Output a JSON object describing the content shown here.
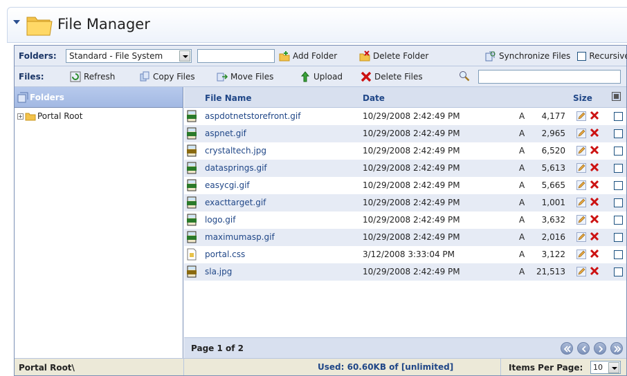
{
  "window": {
    "title": "File Manager"
  },
  "folders_bar": {
    "label": "Folders:",
    "provider_select": "Standard - File System",
    "folder_name_value": "",
    "add_folder": "Add Folder",
    "delete_folder": "Delete Folder",
    "synchronize_files": "Synchronize Files",
    "recursive": "Recursive"
  },
  "files_bar": {
    "label": "Files:",
    "refresh": "Refresh",
    "copy_files": "Copy Files",
    "move_files": "Move Files",
    "upload": "Upload",
    "delete_files": "Delete Files",
    "search_value": ""
  },
  "folders_panel": {
    "header": "Folders",
    "tree": [
      {
        "label": "Portal Root",
        "expanded": false
      }
    ]
  },
  "grid": {
    "columns": {
      "file_name": "File Name",
      "date": "Date",
      "size": "Size"
    },
    "rows": [
      {
        "name": "aspdotnetstorefront.gif",
        "date": "10/29/2008 2:42:49 PM",
        "attr": "A",
        "size": "4,177",
        "type": "GIF"
      },
      {
        "name": "aspnet.gif",
        "date": "10/29/2008 2:42:49 PM",
        "attr": "A",
        "size": "2,965",
        "type": "GIF"
      },
      {
        "name": "crystaltech.jpg",
        "date": "10/29/2008 2:42:49 PM",
        "attr": "A",
        "size": "6,520",
        "type": "JPG"
      },
      {
        "name": "datasprings.gif",
        "date": "10/29/2008 2:42:49 PM",
        "attr": "A",
        "size": "5,613",
        "type": "GIF"
      },
      {
        "name": "easycgi.gif",
        "date": "10/29/2008 2:42:49 PM",
        "attr": "A",
        "size": "5,665",
        "type": "GIF"
      },
      {
        "name": "exacttarget.gif",
        "date": "10/29/2008 2:42:49 PM",
        "attr": "A",
        "size": "1,001",
        "type": "GIF"
      },
      {
        "name": "logo.gif",
        "date": "10/29/2008 2:42:49 PM",
        "attr": "A",
        "size": "3,632",
        "type": "GIF"
      },
      {
        "name": "maximumasp.gif",
        "date": "10/29/2008 2:42:49 PM",
        "attr": "A",
        "size": "2,016",
        "type": "GIF"
      },
      {
        "name": "portal.css",
        "date": "3/12/2008 3:33:04 PM",
        "attr": "A",
        "size": "3,122",
        "type": "CSS"
      },
      {
        "name": "sla.jpg",
        "date": "10/29/2008 2:42:49 PM",
        "attr": "A",
        "size": "21,513",
        "type": "JPG"
      }
    ]
  },
  "pager": {
    "text": "Page 1 of 2"
  },
  "status": {
    "path": "Portal Root\\",
    "used": "Used: 60.60KB of [unlimited]",
    "items_per_page_label": "Items Per Page:",
    "items_per_page_value": "10"
  },
  "colors": {
    "accent": "#1f4687",
    "bar": "#e6ebf5",
    "header": "#d8e0ef",
    "delete": "#cc1111"
  },
  "icons": [
    "chevron-down-icon",
    "folder-icon",
    "add-folder-icon",
    "delete-folder-icon",
    "sync-icon",
    "refresh-icon",
    "copy-icon",
    "move-icon",
    "upload-icon",
    "delete-files-icon",
    "search-icon",
    "edit-icon",
    "delete-icon",
    "select-all-icon",
    "first-page-icon",
    "prev-page-icon",
    "next-page-icon",
    "last-page-icon"
  ]
}
